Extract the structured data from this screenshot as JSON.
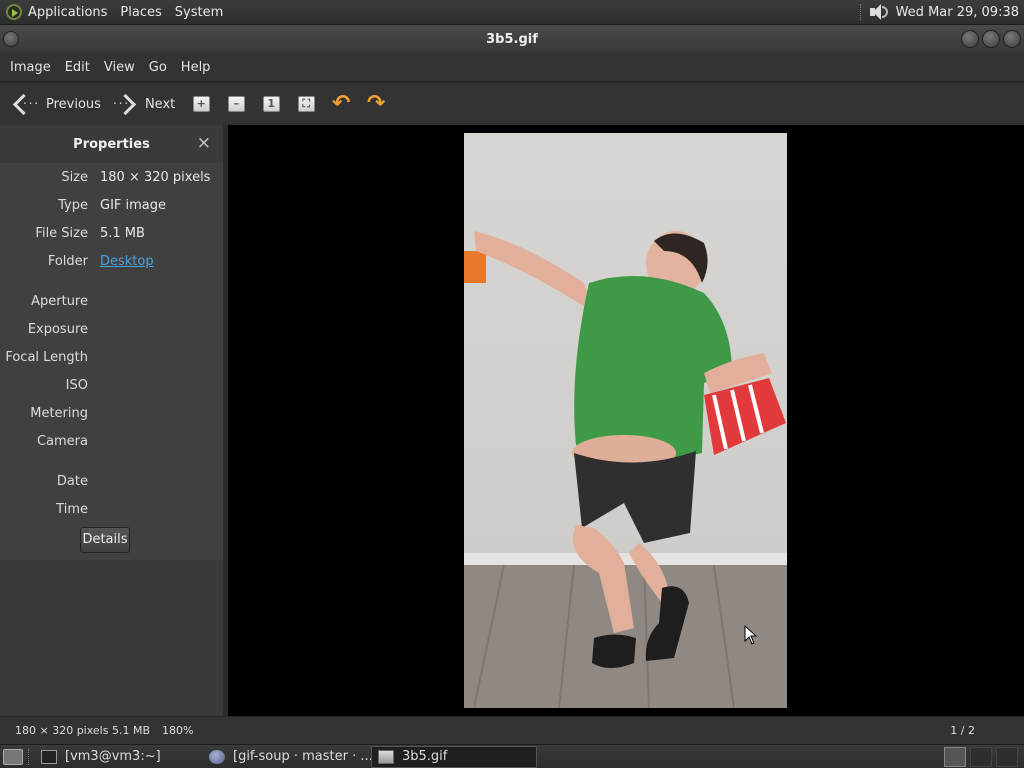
{
  "top_panel": {
    "applications": "Applications",
    "places": "Places",
    "system": "System",
    "clock": "Wed Mar 29, 09:38"
  },
  "window": {
    "title": "3b5.gif"
  },
  "menubar": [
    "Image",
    "Edit",
    "View",
    "Go",
    "Help"
  ],
  "toolbar": {
    "previous": "Previous",
    "next": "Next"
  },
  "sidebar": {
    "title": "Properties",
    "close": "×",
    "props": [
      {
        "key": "Size",
        "value": "180 × 320 pixels"
      },
      {
        "key": "Type",
        "value": "GIF image"
      },
      {
        "key": "File Size",
        "value": "5.1 MB"
      },
      {
        "key": "Folder",
        "value": "Desktop"
      }
    ],
    "exif": [
      {
        "key": "Aperture",
        "value": ""
      },
      {
        "key": "Exposure",
        "value": ""
      },
      {
        "key": "Focal Length",
        "value": ""
      },
      {
        "key": "ISO",
        "value": ""
      },
      {
        "key": "Metering",
        "value": ""
      },
      {
        "key": "Camera",
        "value": ""
      }
    ],
    "datetime": [
      {
        "key": "Date",
        "value": ""
      },
      {
        "key": "Time",
        "value": ""
      }
    ],
    "details_button": "Details"
  },
  "statusbar": {
    "info": "180 × 320 pixels  5.1 MB",
    "zoom": "180%",
    "page": "1 / 2"
  },
  "taskbar": {
    "tasks": [
      {
        "label": "[vm3@vm3:~]",
        "icon": "terminal-icon",
        "active": false
      },
      {
        "label": "[gif-soup · master · ...",
        "icon": "globe-icon",
        "active": false
      },
      {
        "label": "3b5.gif",
        "icon": "image-viewer-icon",
        "active": true
      }
    ]
  },
  "colors": {
    "accent_link": "#4aa3df",
    "rotate_icon": "#f0a030",
    "shirt": "#3f9a48"
  }
}
